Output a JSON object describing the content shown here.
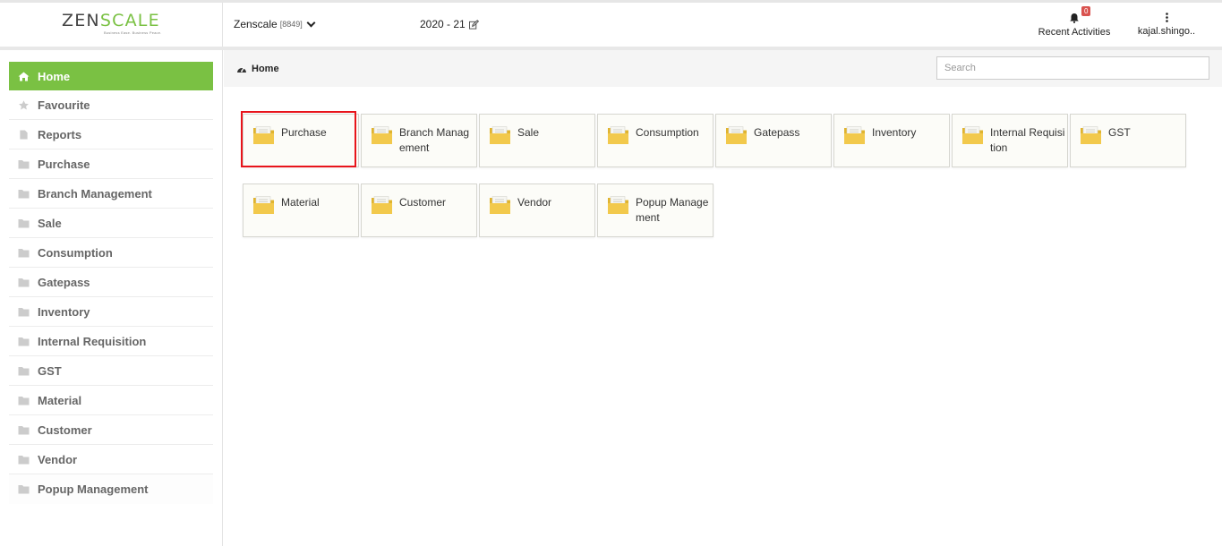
{
  "header": {
    "logo_left": "ZEN",
    "logo_mid": "SC",
    "logo_accent": "A",
    "logo_right": "LE",
    "tagline": "Business Ease. Business Peace.",
    "company_name": "Zenscale",
    "company_code": "[8849]",
    "year": "2020 - 21",
    "notification_count": "0",
    "recent_activities": "Recent Activities",
    "user_name": "kajal.shingo.."
  },
  "sidebar": {
    "items": [
      {
        "label": "Home",
        "icon": "home-icon"
      },
      {
        "label": "Favourite",
        "icon": "star-icon"
      },
      {
        "label": "Reports",
        "icon": "file-icon"
      },
      {
        "label": "Purchase",
        "icon": "folder-icon"
      },
      {
        "label": "Branch Management",
        "icon": "folder-icon"
      },
      {
        "label": "Sale",
        "icon": "folder-icon"
      },
      {
        "label": "Consumption",
        "icon": "folder-icon"
      },
      {
        "label": "Gatepass",
        "icon": "folder-icon"
      },
      {
        "label": "Inventory",
        "icon": "folder-icon"
      },
      {
        "label": "Internal Requisition",
        "icon": "folder-icon"
      },
      {
        "label": "GST",
        "icon": "folder-icon"
      },
      {
        "label": "Material",
        "icon": "folder-icon"
      },
      {
        "label": "Customer",
        "icon": "folder-icon"
      },
      {
        "label": "Vendor",
        "icon": "folder-icon"
      },
      {
        "label": "Popup Management",
        "icon": "folder-icon"
      }
    ]
  },
  "breadcrumb": {
    "label": "Home",
    "icon": "dashboard-icon"
  },
  "search": {
    "placeholder": "Search",
    "value": ""
  },
  "tiles": [
    {
      "label": "Purchase",
      "icon": "folder-icon"
    },
    {
      "label": "Branch Management",
      "icon": "folder-icon"
    },
    {
      "label": "Sale",
      "icon": "folder-icon"
    },
    {
      "label": "Consumption",
      "icon": "folder-icon"
    },
    {
      "label": "Gatepass",
      "icon": "folder-icon"
    },
    {
      "label": "Inventory",
      "icon": "folder-icon"
    },
    {
      "label": "Internal Requisition",
      "icon": "folder-icon"
    },
    {
      "label": "GST",
      "icon": "folder-icon"
    },
    {
      "label": "Material",
      "icon": "folder-icon"
    },
    {
      "label": "Customer",
      "icon": "folder-icon"
    },
    {
      "label": "Vendor",
      "icon": "folder-icon"
    },
    {
      "label": "Popup Management",
      "icon": "folder-icon"
    }
  ],
  "colors": {
    "accent": "#7ac143",
    "highlight": "#e8141b",
    "badge": "#d9534f",
    "folder": "#f2c94c"
  }
}
